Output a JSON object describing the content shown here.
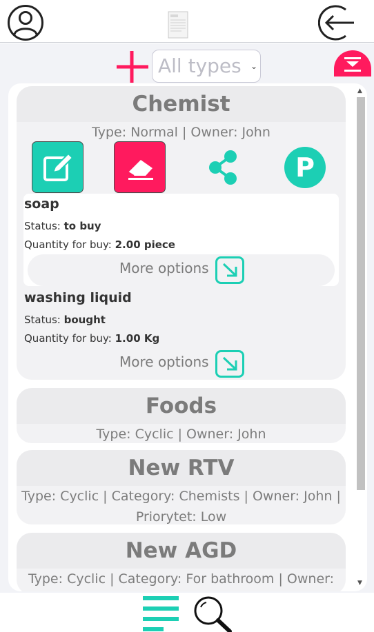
{
  "colors": {
    "accent_teal": "#1ccfb4",
    "accent_pink": "#ff1a5e",
    "title_grey": "#7b7b7b"
  },
  "header": {
    "user_icon": "user-circle-icon",
    "doc_icon": "document-icon",
    "back_icon": "arrow-left-circle-icon"
  },
  "filter": {
    "add_icon": "plus-icon",
    "type_select_value": "All types",
    "collapse_icon": "collapse-all-icon"
  },
  "cards": [
    {
      "title": "Chemist",
      "meta": "Type: Normal | Owner: John",
      "actions": {
        "edit_icon": "edit-icon",
        "erase_icon": "eraser-icon",
        "share_icon": "share-icon",
        "p_label": "P"
      },
      "items": [
        {
          "name": "soap",
          "status_label": "Status: ",
          "status_value": "to buy",
          "qty_label": "Quantity for buy: ",
          "qty_value": "2.00 piece",
          "more_label": "More options"
        },
        {
          "name": "washing liquid",
          "status_label": "Status: ",
          "status_value": "bought",
          "qty_label": "Quantity for buy: ",
          "qty_value": "1.00 Kg",
          "more_label": "More options"
        }
      ]
    },
    {
      "title": "Foods",
      "meta": "Type: Cyclic | Owner: John"
    },
    {
      "title": "New RTV",
      "meta": "Type: Cyclic | Category: Chemists | Owner: John | Priorytet: Low"
    },
    {
      "title": "New AGD",
      "meta": "Type: Cyclic | Category: For bathroom | Owner:"
    }
  ],
  "footer": {
    "menu_icon": "hamburger-menu-icon",
    "search_icon": "search-icon"
  }
}
